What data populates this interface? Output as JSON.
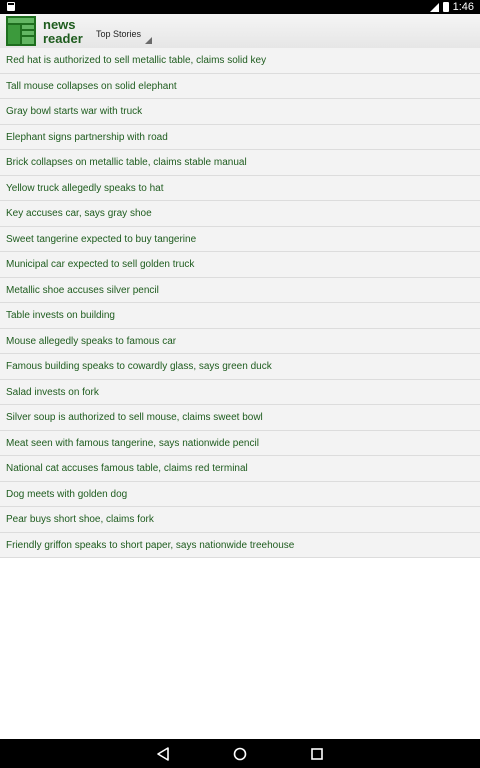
{
  "status_bar": {
    "time": "1:46"
  },
  "app": {
    "title_line1": "news",
    "title_line2": "reader"
  },
  "category_spinner": {
    "selected": "Top Stories"
  },
  "headlines": [
    "Red hat is authorized to sell metallic table, claims solid key",
    "Tall mouse collapses on solid elephant",
    "Gray bowl starts war with truck",
    "Elephant signs partnership with road",
    "Brick collapses on metallic table, claims stable manual",
    "Yellow truck allegedly speaks to hat",
    "Key accuses car, says gray shoe",
    "Sweet tangerine expected to buy tangerine",
    "Municipal car expected to sell golden truck",
    "Metallic shoe accuses silver pencil",
    "Table invests on building",
    "Mouse allegedly speaks to famous car",
    "Famous building speaks to cowardly glass, says green duck",
    "Salad invests on fork",
    "Silver soup is authorized to sell mouse, claims sweet bowl",
    "Meat seen with famous tangerine, says nationwide pencil",
    "National cat accuses famous table, claims red terminal",
    "Dog meets with golden dog",
    "Pear buys short shoe, claims fork",
    "Friendly griffon speaks to short paper, says nationwide treehouse"
  ],
  "colors": {
    "accent": "#1e5c1e",
    "row_background": "#f3f3f3",
    "divider": "#dcdcdc"
  },
  "icons": [
    "notification-icon",
    "signal-icon",
    "battery-icon",
    "app-logo-icon",
    "back-icon",
    "home-icon",
    "recents-icon"
  ]
}
